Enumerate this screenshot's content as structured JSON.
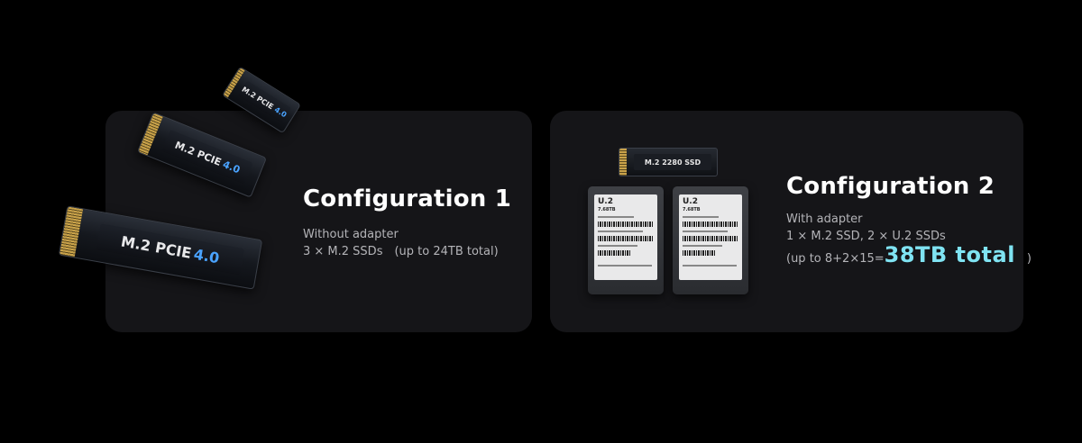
{
  "config1": {
    "title": "Configuration 1",
    "line1": "Without adapter",
    "line2": "3 × M.2 SSDs　(up to 24TB total)",
    "ssd_label": "M.2 PCIE",
    "ssd_version": "4.0"
  },
  "config2": {
    "title": "Configuration 2",
    "line1": "With adapter",
    "line2": "1 × M.2 SSD, 2 × U.2 SSDs",
    "line3_prefix": "(up to 8+2×15=",
    "line3_highlight": "38TB total",
    "line3_suffix": "　)",
    "m2_label": "M.2 2280 SSD",
    "u2_label": "U.2",
    "u2_capacity": "7.68TB"
  },
  "colors": {
    "background": "#000000",
    "card": "#151518",
    "highlight": "#7fe3f2",
    "version_blue": "#4aa3ff"
  }
}
